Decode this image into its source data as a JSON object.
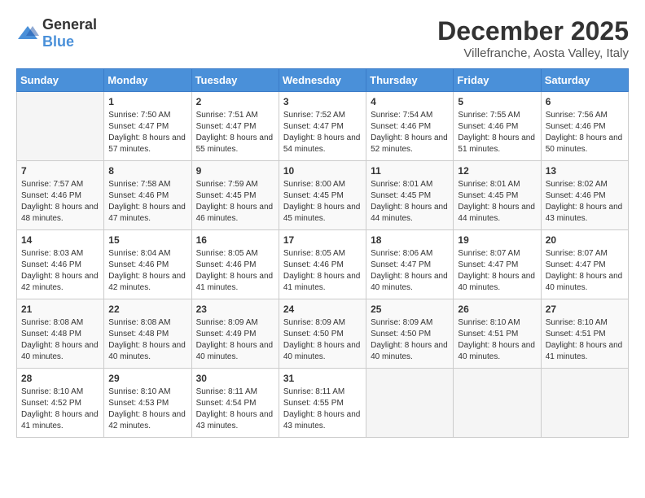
{
  "logo": {
    "general": "General",
    "blue": "Blue"
  },
  "header": {
    "month": "December 2025",
    "location": "Villefranche, Aosta Valley, Italy"
  },
  "days_of_week": [
    "Sunday",
    "Monday",
    "Tuesday",
    "Wednesday",
    "Thursday",
    "Friday",
    "Saturday"
  ],
  "weeks": [
    {
      "days": [
        {
          "num": "",
          "empty": true
        },
        {
          "num": "1",
          "sunrise": "7:50 AM",
          "sunset": "4:47 PM",
          "daylight": "8 hours and 57 minutes."
        },
        {
          "num": "2",
          "sunrise": "7:51 AM",
          "sunset": "4:47 PM",
          "daylight": "8 hours and 55 minutes."
        },
        {
          "num": "3",
          "sunrise": "7:52 AM",
          "sunset": "4:47 PM",
          "daylight": "8 hours and 54 minutes."
        },
        {
          "num": "4",
          "sunrise": "7:54 AM",
          "sunset": "4:46 PM",
          "daylight": "8 hours and 52 minutes."
        },
        {
          "num": "5",
          "sunrise": "7:55 AM",
          "sunset": "4:46 PM",
          "daylight": "8 hours and 51 minutes."
        },
        {
          "num": "6",
          "sunrise": "7:56 AM",
          "sunset": "4:46 PM",
          "daylight": "8 hours and 50 minutes."
        }
      ]
    },
    {
      "days": [
        {
          "num": "7",
          "sunrise": "7:57 AM",
          "sunset": "4:46 PM",
          "daylight": "8 hours and 48 minutes."
        },
        {
          "num": "8",
          "sunrise": "7:58 AM",
          "sunset": "4:46 PM",
          "daylight": "8 hours and 47 minutes."
        },
        {
          "num": "9",
          "sunrise": "7:59 AM",
          "sunset": "4:45 PM",
          "daylight": "8 hours and 46 minutes."
        },
        {
          "num": "10",
          "sunrise": "8:00 AM",
          "sunset": "4:45 PM",
          "daylight": "8 hours and 45 minutes."
        },
        {
          "num": "11",
          "sunrise": "8:01 AM",
          "sunset": "4:45 PM",
          "daylight": "8 hours and 44 minutes."
        },
        {
          "num": "12",
          "sunrise": "8:01 AM",
          "sunset": "4:45 PM",
          "daylight": "8 hours and 44 minutes."
        },
        {
          "num": "13",
          "sunrise": "8:02 AM",
          "sunset": "4:46 PM",
          "daylight": "8 hours and 43 minutes."
        }
      ]
    },
    {
      "days": [
        {
          "num": "14",
          "sunrise": "8:03 AM",
          "sunset": "4:46 PM",
          "daylight": "8 hours and 42 minutes."
        },
        {
          "num": "15",
          "sunrise": "8:04 AM",
          "sunset": "4:46 PM",
          "daylight": "8 hours and 42 minutes."
        },
        {
          "num": "16",
          "sunrise": "8:05 AM",
          "sunset": "4:46 PM",
          "daylight": "8 hours and 41 minutes."
        },
        {
          "num": "17",
          "sunrise": "8:05 AM",
          "sunset": "4:46 PM",
          "daylight": "8 hours and 41 minutes."
        },
        {
          "num": "18",
          "sunrise": "8:06 AM",
          "sunset": "4:47 PM",
          "daylight": "8 hours and 40 minutes."
        },
        {
          "num": "19",
          "sunrise": "8:07 AM",
          "sunset": "4:47 PM",
          "daylight": "8 hours and 40 minutes."
        },
        {
          "num": "20",
          "sunrise": "8:07 AM",
          "sunset": "4:47 PM",
          "daylight": "8 hours and 40 minutes."
        }
      ]
    },
    {
      "days": [
        {
          "num": "21",
          "sunrise": "8:08 AM",
          "sunset": "4:48 PM",
          "daylight": "8 hours and 40 minutes."
        },
        {
          "num": "22",
          "sunrise": "8:08 AM",
          "sunset": "4:48 PM",
          "daylight": "8 hours and 40 minutes."
        },
        {
          "num": "23",
          "sunrise": "8:09 AM",
          "sunset": "4:49 PM",
          "daylight": "8 hours and 40 minutes."
        },
        {
          "num": "24",
          "sunrise": "8:09 AM",
          "sunset": "4:50 PM",
          "daylight": "8 hours and 40 minutes."
        },
        {
          "num": "25",
          "sunrise": "8:09 AM",
          "sunset": "4:50 PM",
          "daylight": "8 hours and 40 minutes."
        },
        {
          "num": "26",
          "sunrise": "8:10 AM",
          "sunset": "4:51 PM",
          "daylight": "8 hours and 40 minutes."
        },
        {
          "num": "27",
          "sunrise": "8:10 AM",
          "sunset": "4:51 PM",
          "daylight": "8 hours and 41 minutes."
        }
      ]
    },
    {
      "days": [
        {
          "num": "28",
          "sunrise": "8:10 AM",
          "sunset": "4:52 PM",
          "daylight": "8 hours and 41 minutes."
        },
        {
          "num": "29",
          "sunrise": "8:10 AM",
          "sunset": "4:53 PM",
          "daylight": "8 hours and 42 minutes."
        },
        {
          "num": "30",
          "sunrise": "8:11 AM",
          "sunset": "4:54 PM",
          "daylight": "8 hours and 43 minutes."
        },
        {
          "num": "31",
          "sunrise": "8:11 AM",
          "sunset": "4:55 PM",
          "daylight": "8 hours and 43 minutes."
        },
        {
          "num": "",
          "empty": true
        },
        {
          "num": "",
          "empty": true
        },
        {
          "num": "",
          "empty": true
        }
      ]
    }
  ]
}
